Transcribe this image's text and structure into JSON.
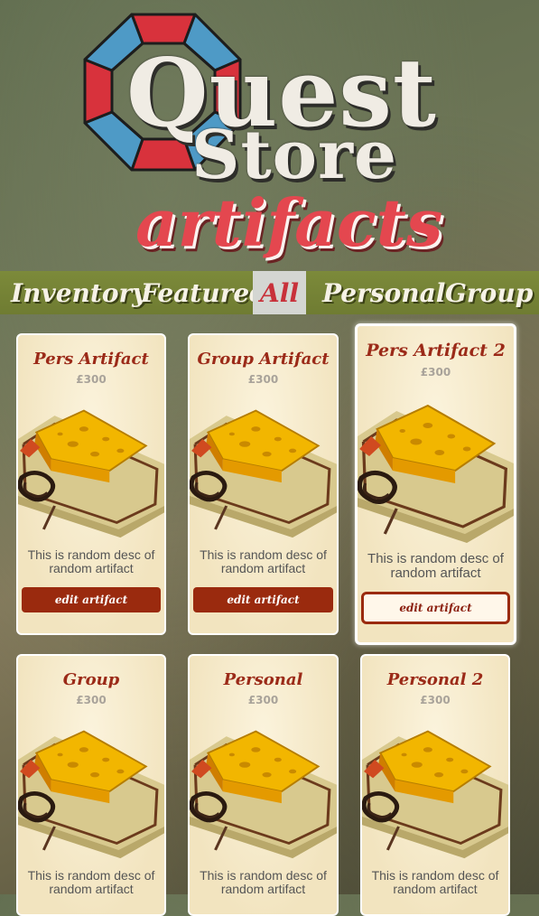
{
  "logo": {
    "line1": "Quest",
    "line2": "Store",
    "subtitle": "artifacts"
  },
  "nav": {
    "items": [
      {
        "label": "Inventory"
      },
      {
        "label": "Featured"
      },
      {
        "label": "All",
        "active": true
      },
      {
        "label": "Personal"
      },
      {
        "label": "Group"
      }
    ]
  },
  "cards": [
    {
      "title": "Pers Artifact",
      "price": "£300",
      "desc": "This is random desc of random artifact",
      "button": "edit artifact"
    },
    {
      "title": "Group Artifact",
      "price": "£300",
      "desc": "This is random desc of random artifact",
      "button": "edit artifact"
    },
    {
      "title": "Pers Artifact 2",
      "price": "£300",
      "desc": "This is random desc of random artifact",
      "button": "edit artifact",
      "hovered": true
    },
    {
      "title": "Group",
      "price": "£300",
      "desc": "This is random desc of random artifact"
    },
    {
      "title": "Personal",
      "price": "£300",
      "desc": "This is random desc of random artifact"
    },
    {
      "title": "Personal 2",
      "price": "£300",
      "desc": "This is random desc of random artifact"
    }
  ],
  "colors": {
    "accent": "#e4474f",
    "button": "#9a2a0e",
    "nav": "#76842f",
    "title": "#9b2a18"
  },
  "icons": {
    "logo": "octagon-ring-icon",
    "product": "mousetrap-cheese-image"
  }
}
